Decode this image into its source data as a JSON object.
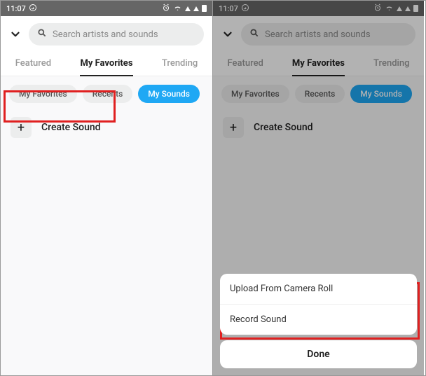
{
  "statusbar": {
    "time": "11:07"
  },
  "search": {
    "placeholder": "Search artists and sounds"
  },
  "tabs": {
    "featured": "Featured",
    "favorites": "My Favorites",
    "trending": "Trending"
  },
  "chips": {
    "favorites": "My Favorites",
    "recents": "Recents",
    "mysounds": "My Sounds"
  },
  "create": {
    "label": "Create Sound"
  },
  "sheet": {
    "upload": "Upload From Camera Roll",
    "record": "Record Sound",
    "done": "Done"
  }
}
